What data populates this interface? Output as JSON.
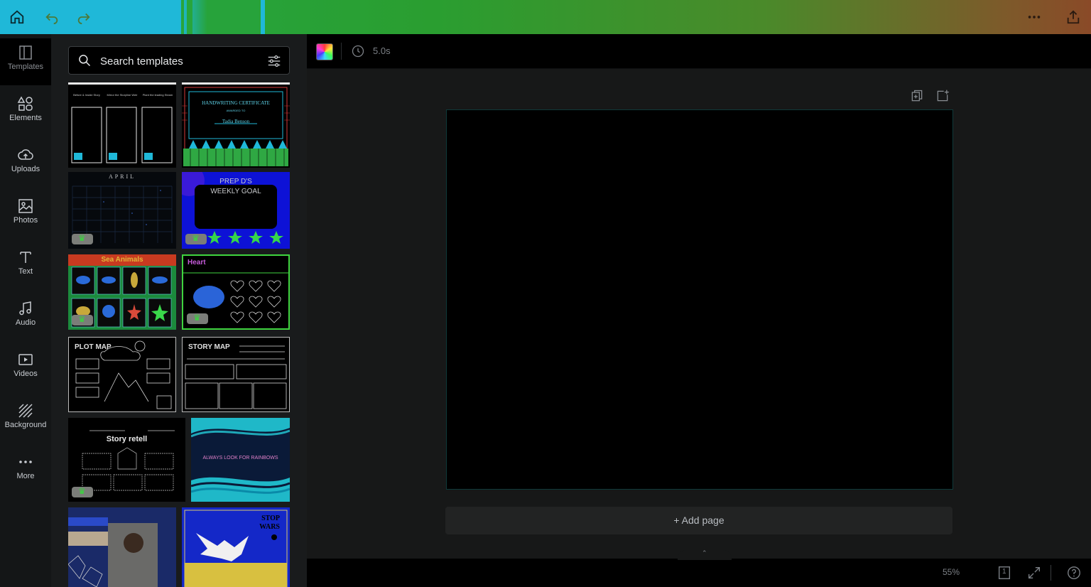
{
  "colors": {
    "topbar_start": "#1fb8d8",
    "topbar_mid": "#2a9e30",
    "topbar_end": "#8a4a28",
    "rail_bg": "#141617",
    "panel_bg": "#191b1c",
    "workspace_bg": "#171818",
    "canvas_bg": "#000000",
    "premium_crown": "#39d63d"
  },
  "topbar": {
    "icons": [
      "home-icon",
      "undo-icon",
      "redo-icon",
      "more-options-icon",
      "share-icon"
    ]
  },
  "sidebar": {
    "items": [
      {
        "key": "templates",
        "label": "Templates",
        "icon": "templates-icon",
        "active": true
      },
      {
        "key": "elements",
        "label": "Elements",
        "icon": "elements-icon"
      },
      {
        "key": "uploads",
        "label": "Uploads",
        "icon": "upload-cloud-icon"
      },
      {
        "key": "photos",
        "label": "Photos",
        "icon": "photo-icon"
      },
      {
        "key": "text",
        "label": "Text",
        "icon": "text-t-icon"
      },
      {
        "key": "audio",
        "label": "Audio",
        "icon": "music-note-icon"
      },
      {
        "key": "videos",
        "label": "Videos",
        "icon": "video-play-icon"
      },
      {
        "key": "background",
        "label": "Background",
        "icon": "hatched-background-icon"
      },
      {
        "key": "more",
        "label": "More",
        "icon": "ellipsis-icon"
      }
    ]
  },
  "panel": {
    "search": {
      "placeholder": "Search templates",
      "icon": "search-icon",
      "filter_icon": "filter-sliders-icon"
    },
    "templates": [
      {
        "name": "template-three-phone-frames",
        "texts": [
          "Before & Inside Story",
          "Mirror the Storyline Weir",
          "Plant the leading Steam"
        ],
        "premium": false
      },
      {
        "name": "template-handwriting-certificate",
        "texts": [
          "HANDWRITING CERTIFICATE",
          "AWARDED TO",
          "Tadia Benson"
        ],
        "premium": false
      },
      {
        "name": "template-april-calendar",
        "texts": [
          "APRIL"
        ],
        "premium": true
      },
      {
        "name": "template-weekly-goal",
        "texts": [
          "PREP D'S",
          "WEEKLY GOAL"
        ],
        "premium": true
      },
      {
        "name": "template-sea-animals",
        "texts": [
          "Sea Animals"
        ],
        "premium": true
      },
      {
        "name": "template-heart-worksheet",
        "texts": [
          "Heart"
        ],
        "premium": true
      },
      {
        "name": "template-plot-map",
        "texts": [
          "PLOT MAP"
        ],
        "premium": false
      },
      {
        "name": "template-story-map",
        "texts": [
          "STORY MAP"
        ],
        "premium": false
      },
      {
        "name": "template-story-retell",
        "texts": [
          "Story retell"
        ],
        "premium": true
      },
      {
        "name": "template-always-look-for-rainbows",
        "texts": [
          "ALWAYS LOOK FOR RAINBOWS"
        ],
        "premium": false
      },
      {
        "name": "template-collage-poster",
        "texts": [],
        "premium": false
      },
      {
        "name": "template-stop-wars-poster",
        "texts": [
          "STOP",
          "WARS"
        ],
        "premium": false
      }
    ]
  },
  "editor": {
    "duration": "5.0s",
    "add_page": "+ Add page",
    "zoom": "55%",
    "page_count": "1"
  }
}
